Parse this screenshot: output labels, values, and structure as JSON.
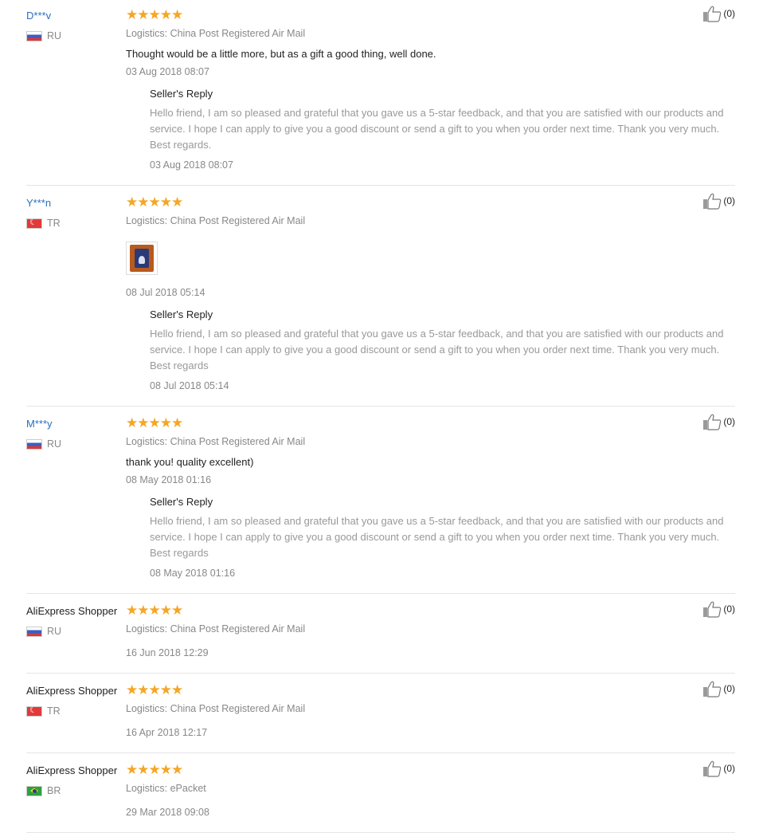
{
  "like_count": "(0)",
  "reviews": [
    {
      "user": "D***v",
      "country": "RU",
      "stars": "★★★★★",
      "logistics": "Logistics: China Post Registered Air Mail",
      "comment": "Thought would be a little more, but as a gift a good thing, well done.",
      "date": "03 Aug 2018 08:07",
      "reply_title": "Seller's Reply",
      "reply_text": "Hello friend, I am so pleased and grateful that you gave us a 5-star feedback, and that you are satisfied with our products and service. I hope I can apply to give you a good discount or send a gift to you when you order next time. Thank you very much. Best regards.",
      "reply_date": "03 Aug 2018 08:07"
    },
    {
      "user": "Y***n",
      "country": "TR",
      "stars": "★★★★★",
      "logistics": "Logistics: China Post Registered Air Mail",
      "date": "08 Jul 2018 05:14",
      "reply_title": "Seller's Reply",
      "reply_text": "Hello friend, I am so pleased and grateful that you gave us a 5-star feedback, and that you are satisfied with our products and service. I hope I can apply to give you a good discount or send a gift to you when you order next time. Thank you very much. Best regards",
      "reply_date": "08 Jul 2018 05:14"
    },
    {
      "user": "M***y",
      "country": "RU",
      "stars": "★★★★★",
      "logistics": "Logistics: China Post Registered Air Mail",
      "comment": "thank you! quality excellent)",
      "date": "08 May 2018 01:16",
      "reply_title": "Seller's Reply",
      "reply_text": "Hello friend, I am so pleased and grateful that you gave us a 5-star feedback, and that you are satisfied with our products and service. I hope I can apply to give you a good discount or send a gift to you when you order next time. Thank you very much. Best regards",
      "reply_date": "08 May 2018 01:16"
    },
    {
      "user": "AliExpress Shopper",
      "country": "RU",
      "stars": "★★★★★",
      "logistics": "Logistics: China Post Registered Air Mail",
      "date": "16 Jun 2018 12:29"
    },
    {
      "user": "AliExpress Shopper",
      "country": "TR",
      "stars": "★★★★★",
      "logistics": "Logistics: China Post Registered Air Mail",
      "date": "16 Apr 2018 12:17"
    },
    {
      "user": "AliExpress Shopper",
      "country": "BR",
      "stars": "★★★★★",
      "logistics": "Logistics: ePacket",
      "date": "29 Mar 2018 09:08"
    }
  ]
}
